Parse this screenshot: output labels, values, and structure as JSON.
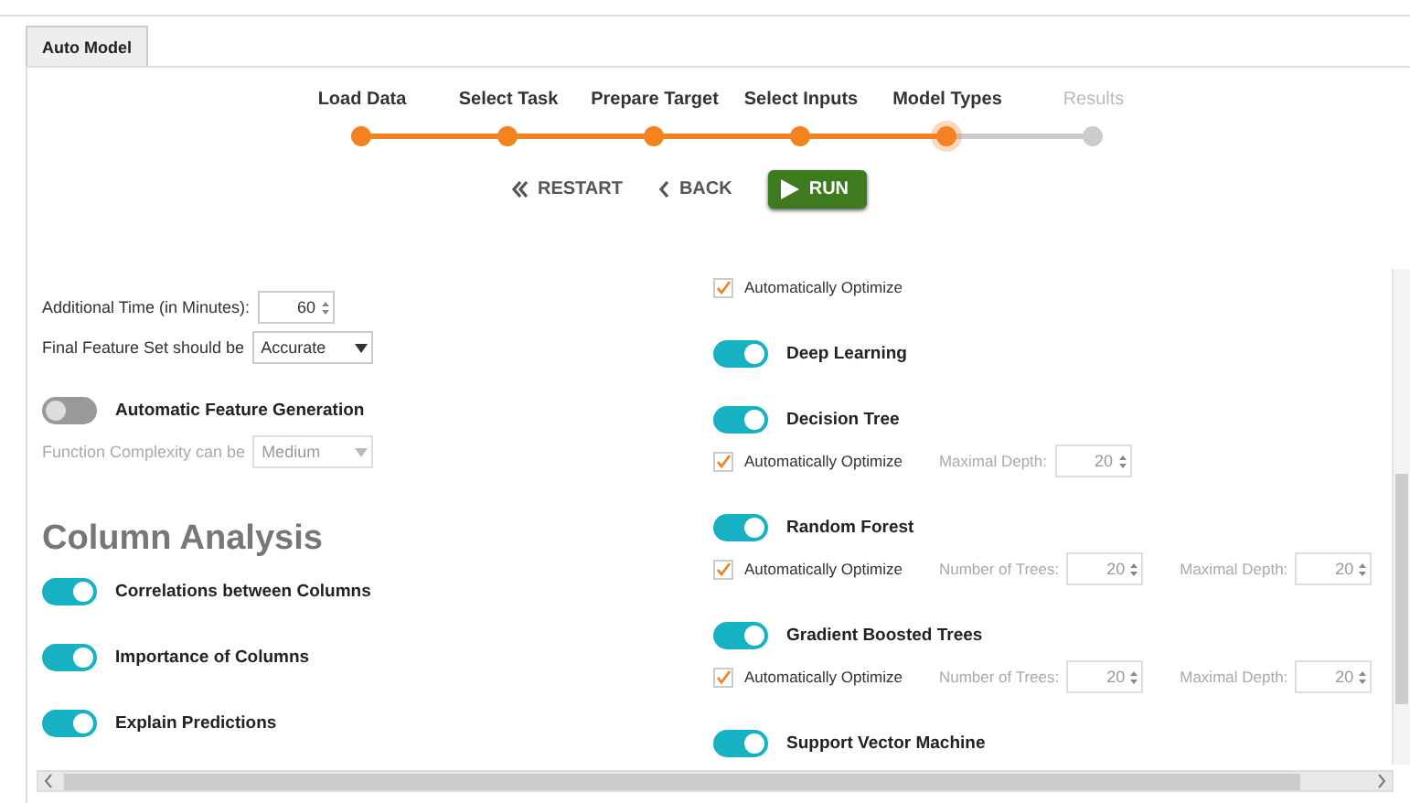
{
  "tabs": [
    {
      "label": "Auto Model",
      "selected": true
    }
  ],
  "steps": [
    {
      "label": "Load Data",
      "completed": true,
      "selected": false
    },
    {
      "label": "Select Task",
      "completed": true,
      "selected": false
    },
    {
      "label": "Prepare Target",
      "completed": true,
      "selected": false
    },
    {
      "label": "Select Inputs",
      "completed": true,
      "selected": false
    },
    {
      "label": "Model Types",
      "completed": false,
      "selected": true
    },
    {
      "label": "Results",
      "completed": false,
      "selected": false
    }
  ],
  "actions": [
    {
      "kind": "restart",
      "label": "RESTART"
    },
    {
      "kind": "back",
      "label": "BACK"
    },
    {
      "kind": "run",
      "label": "RUN"
    }
  ],
  "left": [
    {
      "kind": "spinner",
      "label": "Additional Time (in Minutes):",
      "value": "60",
      "disabled": false
    },
    {
      "kind": "select",
      "label": "Final Feature Set should be",
      "value": "Accurate",
      "disabled": false
    },
    {
      "kind": "toggle",
      "label": "Automatic Feature Generation",
      "on": false
    },
    {
      "kind": "select",
      "label": "Function Complexity can be",
      "value": "Medium",
      "disabled": true
    },
    {
      "kind": "heading",
      "label": "Column Analysis"
    },
    {
      "kind": "toggle",
      "label": "Correlations between Columns",
      "on": true
    },
    {
      "kind": "toggle",
      "label": "Importance of Columns",
      "on": true
    },
    {
      "kind": "toggle",
      "label": "Explain Predictions",
      "on": true
    }
  ],
  "right": [
    {
      "kind": "checkbox",
      "label": "Automatically Optimize",
      "checked": true
    },
    {
      "kind": "toggle",
      "label": "Deep Learning",
      "on": true
    },
    {
      "kind": "toggle",
      "label": "Decision Tree",
      "on": true
    },
    {
      "kind": "checkbox",
      "label": "Automatically Optimize",
      "checked": true,
      "params": [
        {
          "label": "Maximal Depth:",
          "value": "20",
          "disabled": true
        }
      ]
    },
    {
      "kind": "toggle",
      "label": "Random Forest",
      "on": true
    },
    {
      "kind": "checkbox",
      "label": "Automatically Optimize",
      "checked": true,
      "params": [
        {
          "label": "Number of Trees:",
          "value": "20",
          "disabled": true
        },
        {
          "label": "Maximal Depth:",
          "value": "20",
          "disabled": true
        }
      ]
    },
    {
      "kind": "toggle",
      "label": "Gradient Boosted Trees",
      "on": true
    },
    {
      "kind": "checkbox",
      "label": "Automatically Optimize",
      "checked": true,
      "params": [
        {
          "label": "Number of Trees:",
          "value": "20",
          "disabled": true
        },
        {
          "label": "Maximal Depth:",
          "value": "20",
          "disabled": true
        }
      ]
    },
    {
      "kind": "toggle",
      "label": "Support Vector Machine",
      "on": true
    }
  ]
}
